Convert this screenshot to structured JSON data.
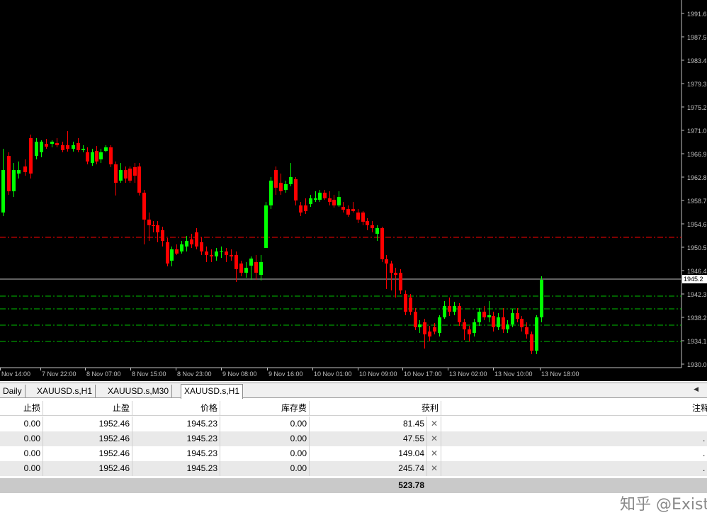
{
  "chart": {
    "symbol_tab": "XAUUSD.s,H1",
    "price_levels": [
      "1991.6",
      "1987.5",
      "1983.4",
      "1979.3",
      "1975.2",
      "1971.0",
      "1966.9",
      "1962.8",
      "1958.7",
      "1954.6",
      "1950.5",
      "1946.4",
      "1942.3",
      "1938.2",
      "1934.1",
      "1930.0"
    ],
    "current_price": "1945.2",
    "time_labels": [
      "Nov 14:00",
      "7 Nov 22:00",
      "8 Nov 07:00",
      "8 Nov 15:00",
      "8 Nov 23:00",
      "9 Nov 08:00",
      "9 Nov 16:00",
      "10 Nov 01:00",
      "10 Nov 09:00",
      "10 Nov 17:00",
      "13 Nov 02:00",
      "13 Nov 10:00",
      "13 Nov 18:00"
    ],
    "colors": {
      "background": "#000000",
      "bull": "#00ff00",
      "bear": "#ff0000",
      "stop_loss_line": "#ff0000",
      "take_profit_line": "#00c000",
      "bid_line": "#c0c0c0"
    }
  },
  "tabs": [
    {
      "label": "Daily"
    },
    {
      "label": "XAUUSD.s,H1"
    },
    {
      "label": "XAUUSD.s,M30"
    },
    {
      "label": "XAUUSD.s,H1",
      "active": true
    }
  ],
  "table": {
    "headers": [
      "止损",
      "止盈",
      "价格",
      "库存费",
      "获利",
      "注释"
    ],
    "rows": [
      {
        "sl": "0.00",
        "tp": "1952.46",
        "price": "1945.23",
        "swap": "0.00",
        "profit": "81.45"
      },
      {
        "sl": "0.00",
        "tp": "1952.46",
        "price": "1945.23",
        "swap": "0.00",
        "profit": "47.55"
      },
      {
        "sl": "0.00",
        "tp": "1952.46",
        "price": "1945.23",
        "swap": "0.00",
        "profit": "149.04"
      },
      {
        "sl": "0.00",
        "tp": "1952.46",
        "price": "1945.23",
        "swap": "0.00",
        "profit": "245.74"
      }
    ],
    "close_icon": "close-icon",
    "total_profit": "523.78"
  },
  "watermark": "知乎 @Exist"
}
